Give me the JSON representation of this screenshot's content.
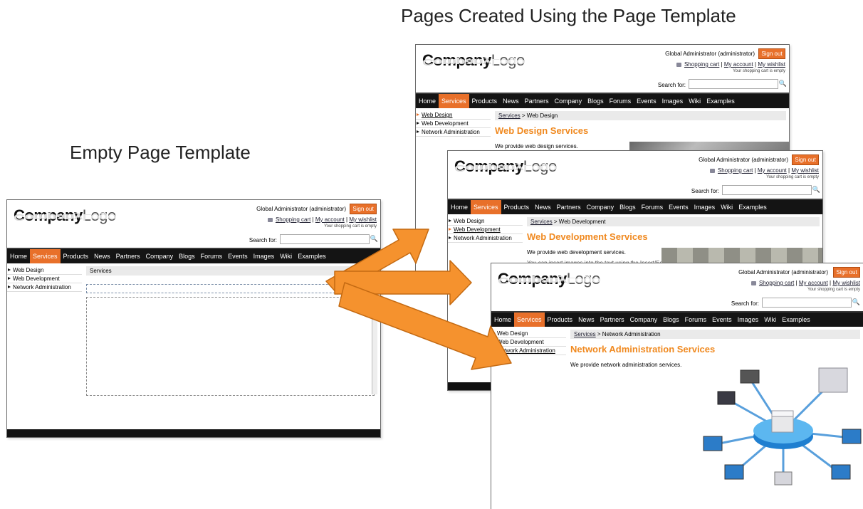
{
  "headings": {
    "empty": "Empty Page Template",
    "created": "Pages Created Using the Page Template"
  },
  "site": {
    "logo_bold": "Company",
    "logo_light": "Logo",
    "user_text": "Global Administrator (administrator)",
    "signout": "Sign out",
    "shopping_cart": "Shopping cart",
    "my_account": "My account",
    "my_wishlist": "My wishlist",
    "sep": "|",
    "cart_empty": "Your shopping cart is empty",
    "search_label": "Search for:",
    "nav": [
      "Home",
      "Services",
      "Products",
      "News",
      "Partners",
      "Company",
      "Blogs",
      "Forums",
      "Events",
      "Images",
      "Wiki",
      "Examples"
    ],
    "side": [
      "Web Design",
      "Web Development",
      "Network Administration"
    ]
  },
  "template_page": {
    "crumb": "Services"
  },
  "page_design": {
    "crumb_link": "Services",
    "crumb_rest": " > Web Design",
    "title": "Web Design Services",
    "desc": "We provide web design services."
  },
  "page_dev": {
    "crumb_link": "Services",
    "crumb_rest": " > Web Development",
    "title": "Web Development Services",
    "desc": "We provide web development services.",
    "desc2": "You can insert images into the text using the Insert/Edit"
  },
  "page_net": {
    "crumb_link": "Services",
    "crumb_rest": " > Network Administration",
    "title": "Network Administration Services",
    "desc": "We provide network administration services."
  },
  "colors": {
    "accent": "#e8702a",
    "title_orange": "#f0891f",
    "arrow": "#f5922e",
    "nav_bg": "#141414"
  }
}
